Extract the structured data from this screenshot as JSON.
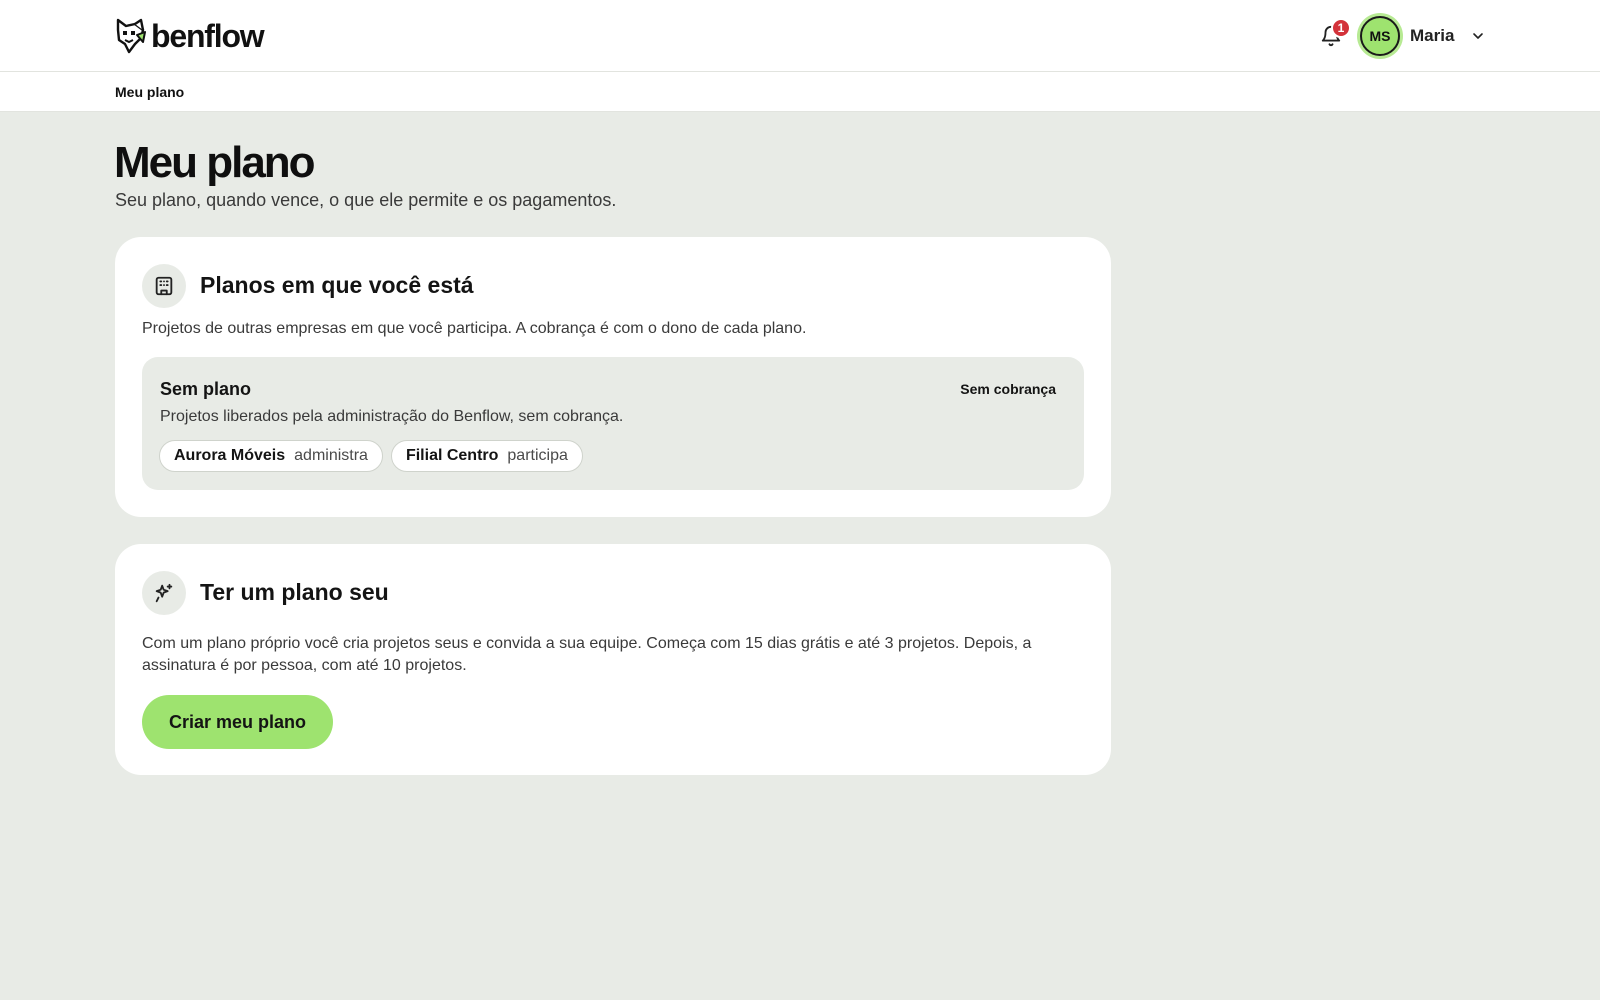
{
  "header": {
    "logo_text": "benflow",
    "notifications_count": "1",
    "user_initials": "MS",
    "user_name": "Maria"
  },
  "breadcrumb": {
    "current": "Meu plano"
  },
  "page": {
    "title": "Meu plano",
    "subtitle": "Seu plano, quando vence, o que ele permite e os pagamentos."
  },
  "plans_section": {
    "icon": "building-icon",
    "title": "Planos em que você está",
    "description": "Projetos de outras empresas em que você participa. A cobrança é com o dono de cada plano.",
    "plan": {
      "name": "Sem plano",
      "billing": "Sem cobrança",
      "description": "Projetos liberados pela administração do Benflow, sem cobrança.",
      "projects": [
        {
          "name": "Aurora Móveis",
          "role": "administra"
        },
        {
          "name": "Filial Centro",
          "role": "participa"
        }
      ]
    }
  },
  "own_plan_section": {
    "icon": "sparkles-icon",
    "title": "Ter um plano seu",
    "description": "Com um plano próprio você cria projetos seus e convida a sua equipe. Começa com 15 dias grátis e até 3 projetos. Depois, a assinatura é por pessoa, com até 10 projetos.",
    "cta_label": "Criar meu plano"
  },
  "colors": {
    "accent": "#9ee36f",
    "badge": "#d3323a",
    "background": "#e8ebe6"
  }
}
